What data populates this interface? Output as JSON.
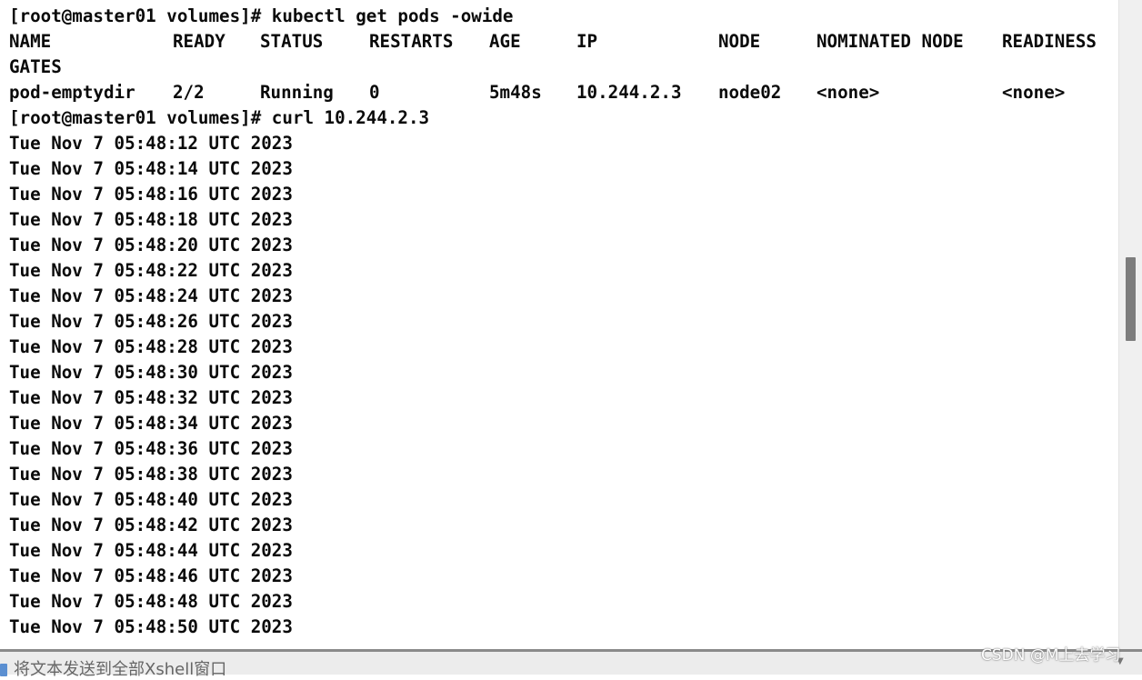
{
  "terminal": {
    "prompt1": "[root@master01 volumes]# kubectl get pods -owide",
    "headers": [
      "NAME",
      "READY",
      "STATUS",
      "RESTARTS",
      "AGE",
      "IP",
      "NODE",
      "NOMINATED NODE",
      "READINESS"
    ],
    "header_wrap": "GATES",
    "pod_row": [
      "pod-emptydir",
      "2/2",
      "Running",
      "0",
      "5m48s",
      "10.244.2.3",
      "node02",
      "<none>",
      "<none>"
    ],
    "prompt2": "[root@master01 volumes]# curl 10.244.2.3",
    "outputs": [
      "Tue Nov 7 05:48:12 UTC 2023",
      "Tue Nov 7 05:48:14 UTC 2023",
      "Tue Nov 7 05:48:16 UTC 2023",
      "Tue Nov 7 05:48:18 UTC 2023",
      "Tue Nov 7 05:48:20 UTC 2023",
      "Tue Nov 7 05:48:22 UTC 2023",
      "Tue Nov 7 05:48:24 UTC 2023",
      "Tue Nov 7 05:48:26 UTC 2023",
      "Tue Nov 7 05:48:28 UTC 2023",
      "Tue Nov 7 05:48:30 UTC 2023",
      "Tue Nov 7 05:48:32 UTC 2023",
      "Tue Nov 7 05:48:34 UTC 2023",
      "Tue Nov 7 05:48:36 UTC 2023",
      "Tue Nov 7 05:48:38 UTC 2023",
      "Tue Nov 7 05:48:40 UTC 2023",
      "Tue Nov 7 05:48:42 UTC 2023",
      "Tue Nov 7 05:48:44 UTC 2023",
      "Tue Nov 7 05:48:46 UTC 2023",
      "Tue Nov 7 05:48:48 UTC 2023",
      "Tue Nov 7 05:48:50 UTC 2023"
    ]
  },
  "statusbar": {
    "compose_text": "将文本发送到全部Xshell窗口",
    "compose_icon": "compose-icon"
  },
  "watermark": "CSDN @M上去学习",
  "colors": {
    "text": "#0a0a0a",
    "background": "#ffffff",
    "scrollbar_thumb": "#7d7d7d",
    "statusbar": "#ececec"
  }
}
